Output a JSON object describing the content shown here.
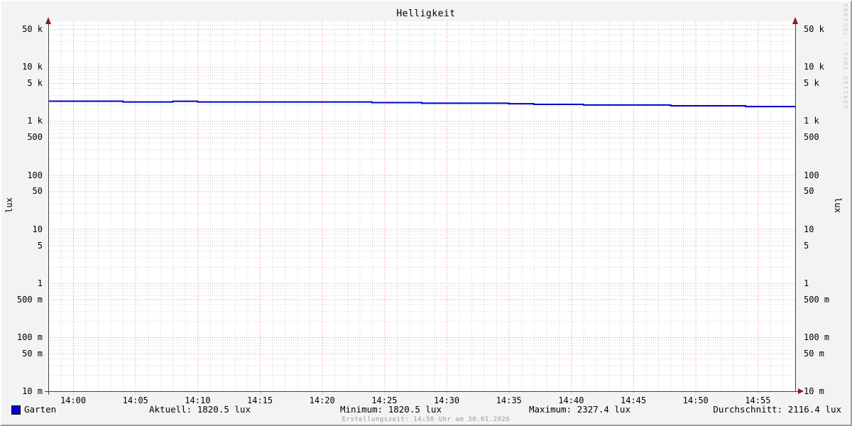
{
  "title": "Helligkeit",
  "watermark": "RRDTOOL / TOBI OETIKER",
  "axis_unit_left": "lux",
  "axis_unit_right": "lux",
  "legend": {
    "series_label": "Garten",
    "series_color": "#0000cc"
  },
  "stats_row": {
    "aktuell": "Aktuell: 1820.5 lux",
    "minimum": "Minimum: 1820.5 lux",
    "maximum": "Maximum: 2327.4 lux",
    "durchschnitt": "Durchschnitt: 2116.4 lux"
  },
  "footer": "Erstellungszeit: 14:58 Uhr am 30.01.2026",
  "chart_data": {
    "type": "line",
    "title": "Helligkeit",
    "ylabel": "lux",
    "y_scale": "log",
    "grid": true,
    "legend_position": "bottom",
    "xlim": [
      "13:58",
      "14:58"
    ],
    "ylim": [
      0.01,
      70000
    ],
    "x_tick_interval_minutes": 5,
    "x_minor_interval_minutes": 1,
    "x_ticks": [
      "14:00",
      "14:05",
      "14:10",
      "14:15",
      "14:20",
      "14:25",
      "14:30",
      "14:35",
      "14:40",
      "14:45",
      "14:50",
      "14:55"
    ],
    "y_ticks": [
      {
        "label": "50 k",
        "value": 50000
      },
      {
        "label": "10 k",
        "value": 10000
      },
      {
        "label": "5 k",
        "value": 5000
      },
      {
        "label": "1 k",
        "value": 1000
      },
      {
        "label": "500",
        "value": 500
      },
      {
        "label": "100",
        "value": 100
      },
      {
        "label": "50",
        "value": 50
      },
      {
        "label": "10",
        "value": 10
      },
      {
        "label": "5",
        "value": 5
      },
      {
        "label": "1",
        "value": 1
      },
      {
        "label": "500 m",
        "value": 0.5
      },
      {
        "label": "100 m",
        "value": 0.1
      },
      {
        "label": "50 m",
        "value": 0.05
      },
      {
        "label": "10 m",
        "value": 0.01
      }
    ],
    "series": [
      {
        "name": "Garten",
        "color": "#0000cc",
        "points": [
          [
            "13:58",
            2327.4
          ],
          [
            "14:04",
            2250
          ],
          [
            "14:08",
            2320
          ],
          [
            "14:10",
            2250
          ],
          [
            "14:24",
            2190
          ],
          [
            "14:28",
            2130
          ],
          [
            "14:35",
            2090
          ],
          [
            "14:37",
            2030
          ],
          [
            "14:41",
            1975
          ],
          [
            "14:48",
            1910
          ],
          [
            "14:54",
            1850
          ],
          [
            "14:58",
            1820.5
          ]
        ]
      }
    ],
    "stats": {
      "aktuell": 1820.5,
      "minimum": 1820.5,
      "maximum": 2327.4,
      "durchschnitt": 2116.4,
      "unit": "lux"
    },
    "colors": {
      "canvas": "#ffffff",
      "background": "#f3f3f3",
      "major_grid": "#e07070",
      "minor_grid": "#bbbbbb",
      "axis": "#444444",
      "arrow": "#8b1c1c",
      "line": "#0000cc"
    }
  }
}
